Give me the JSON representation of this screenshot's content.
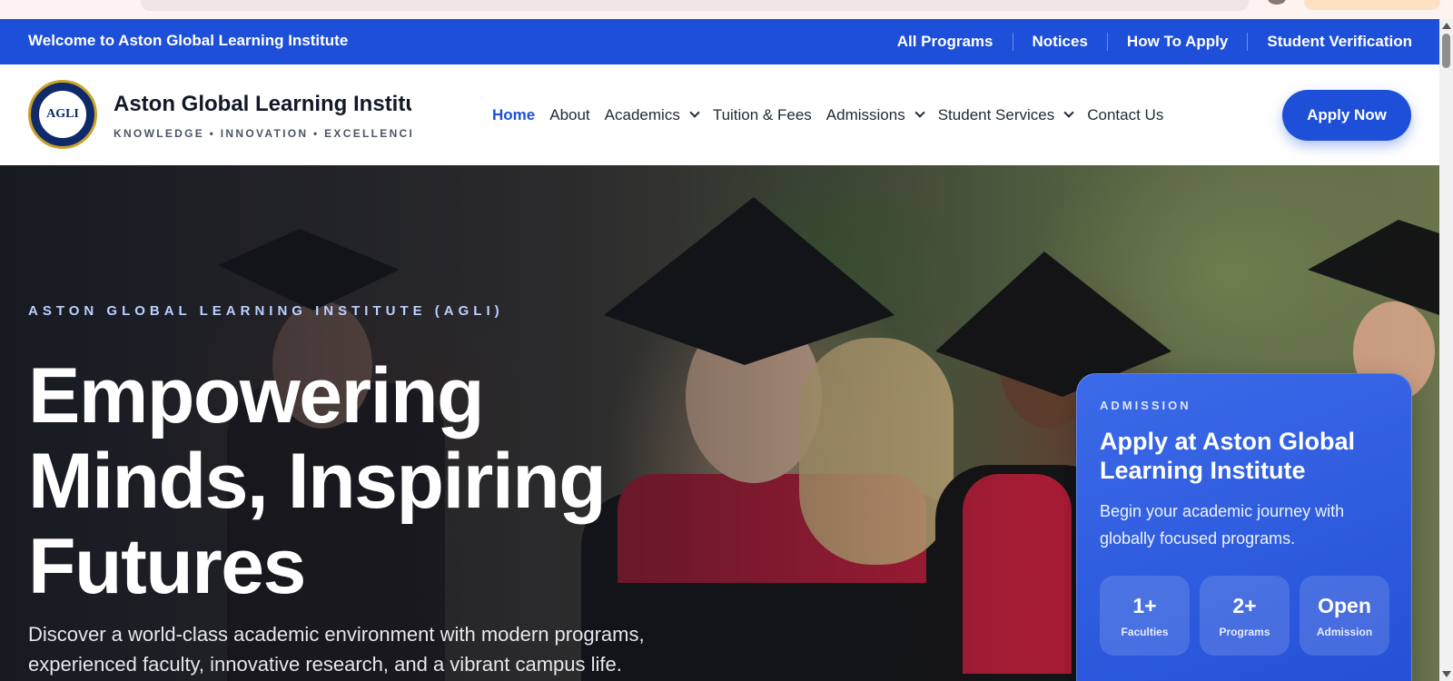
{
  "topbar": {
    "welcome": "Welcome to Aston Global Learning Institute",
    "links": [
      "All Programs",
      "Notices",
      "How To Apply",
      "Student Verification"
    ]
  },
  "header": {
    "logo_text": "AGLI",
    "brand_name": "Aston Global Learning Institute",
    "tagline": "KNOWLEDGE • INNOVATION • EXCELLENCE",
    "nav": [
      {
        "label": "Home",
        "active": true,
        "dropdown": false
      },
      {
        "label": "About",
        "active": false,
        "dropdown": false
      },
      {
        "label": "Academics",
        "active": false,
        "dropdown": true
      },
      {
        "label": "Tuition & Fees",
        "active": false,
        "dropdown": false
      },
      {
        "label": "Admissions",
        "active": false,
        "dropdown": true
      },
      {
        "label": "Student Services",
        "active": false,
        "dropdown": true
      },
      {
        "label": "Contact Us",
        "active": false,
        "dropdown": false
      }
    ],
    "cta": "Apply Now"
  },
  "hero": {
    "eyebrow": "ASTON GLOBAL LEARNING INSTITUTE (AGLI)",
    "headline": "Empowering Minds, Inspiring Futures",
    "subtext": "Discover a world-class academic environment with modern programs, experienced faculty, innovative research, and a vibrant campus life."
  },
  "admission_card": {
    "kicker": "ADMISSION",
    "title": "Apply at Aston Global Learning Institute",
    "description": "Begin your academic journey with globally focused programs.",
    "stats": [
      {
        "value": "1+",
        "label": "Faculties"
      },
      {
        "value": "2+",
        "label": "Programs"
      },
      {
        "value": "Open",
        "label": "Admission"
      }
    ]
  },
  "colors": {
    "primary": "#1d4fd8",
    "text_dark": "#111827",
    "card_bg": "#2f5fe0"
  }
}
